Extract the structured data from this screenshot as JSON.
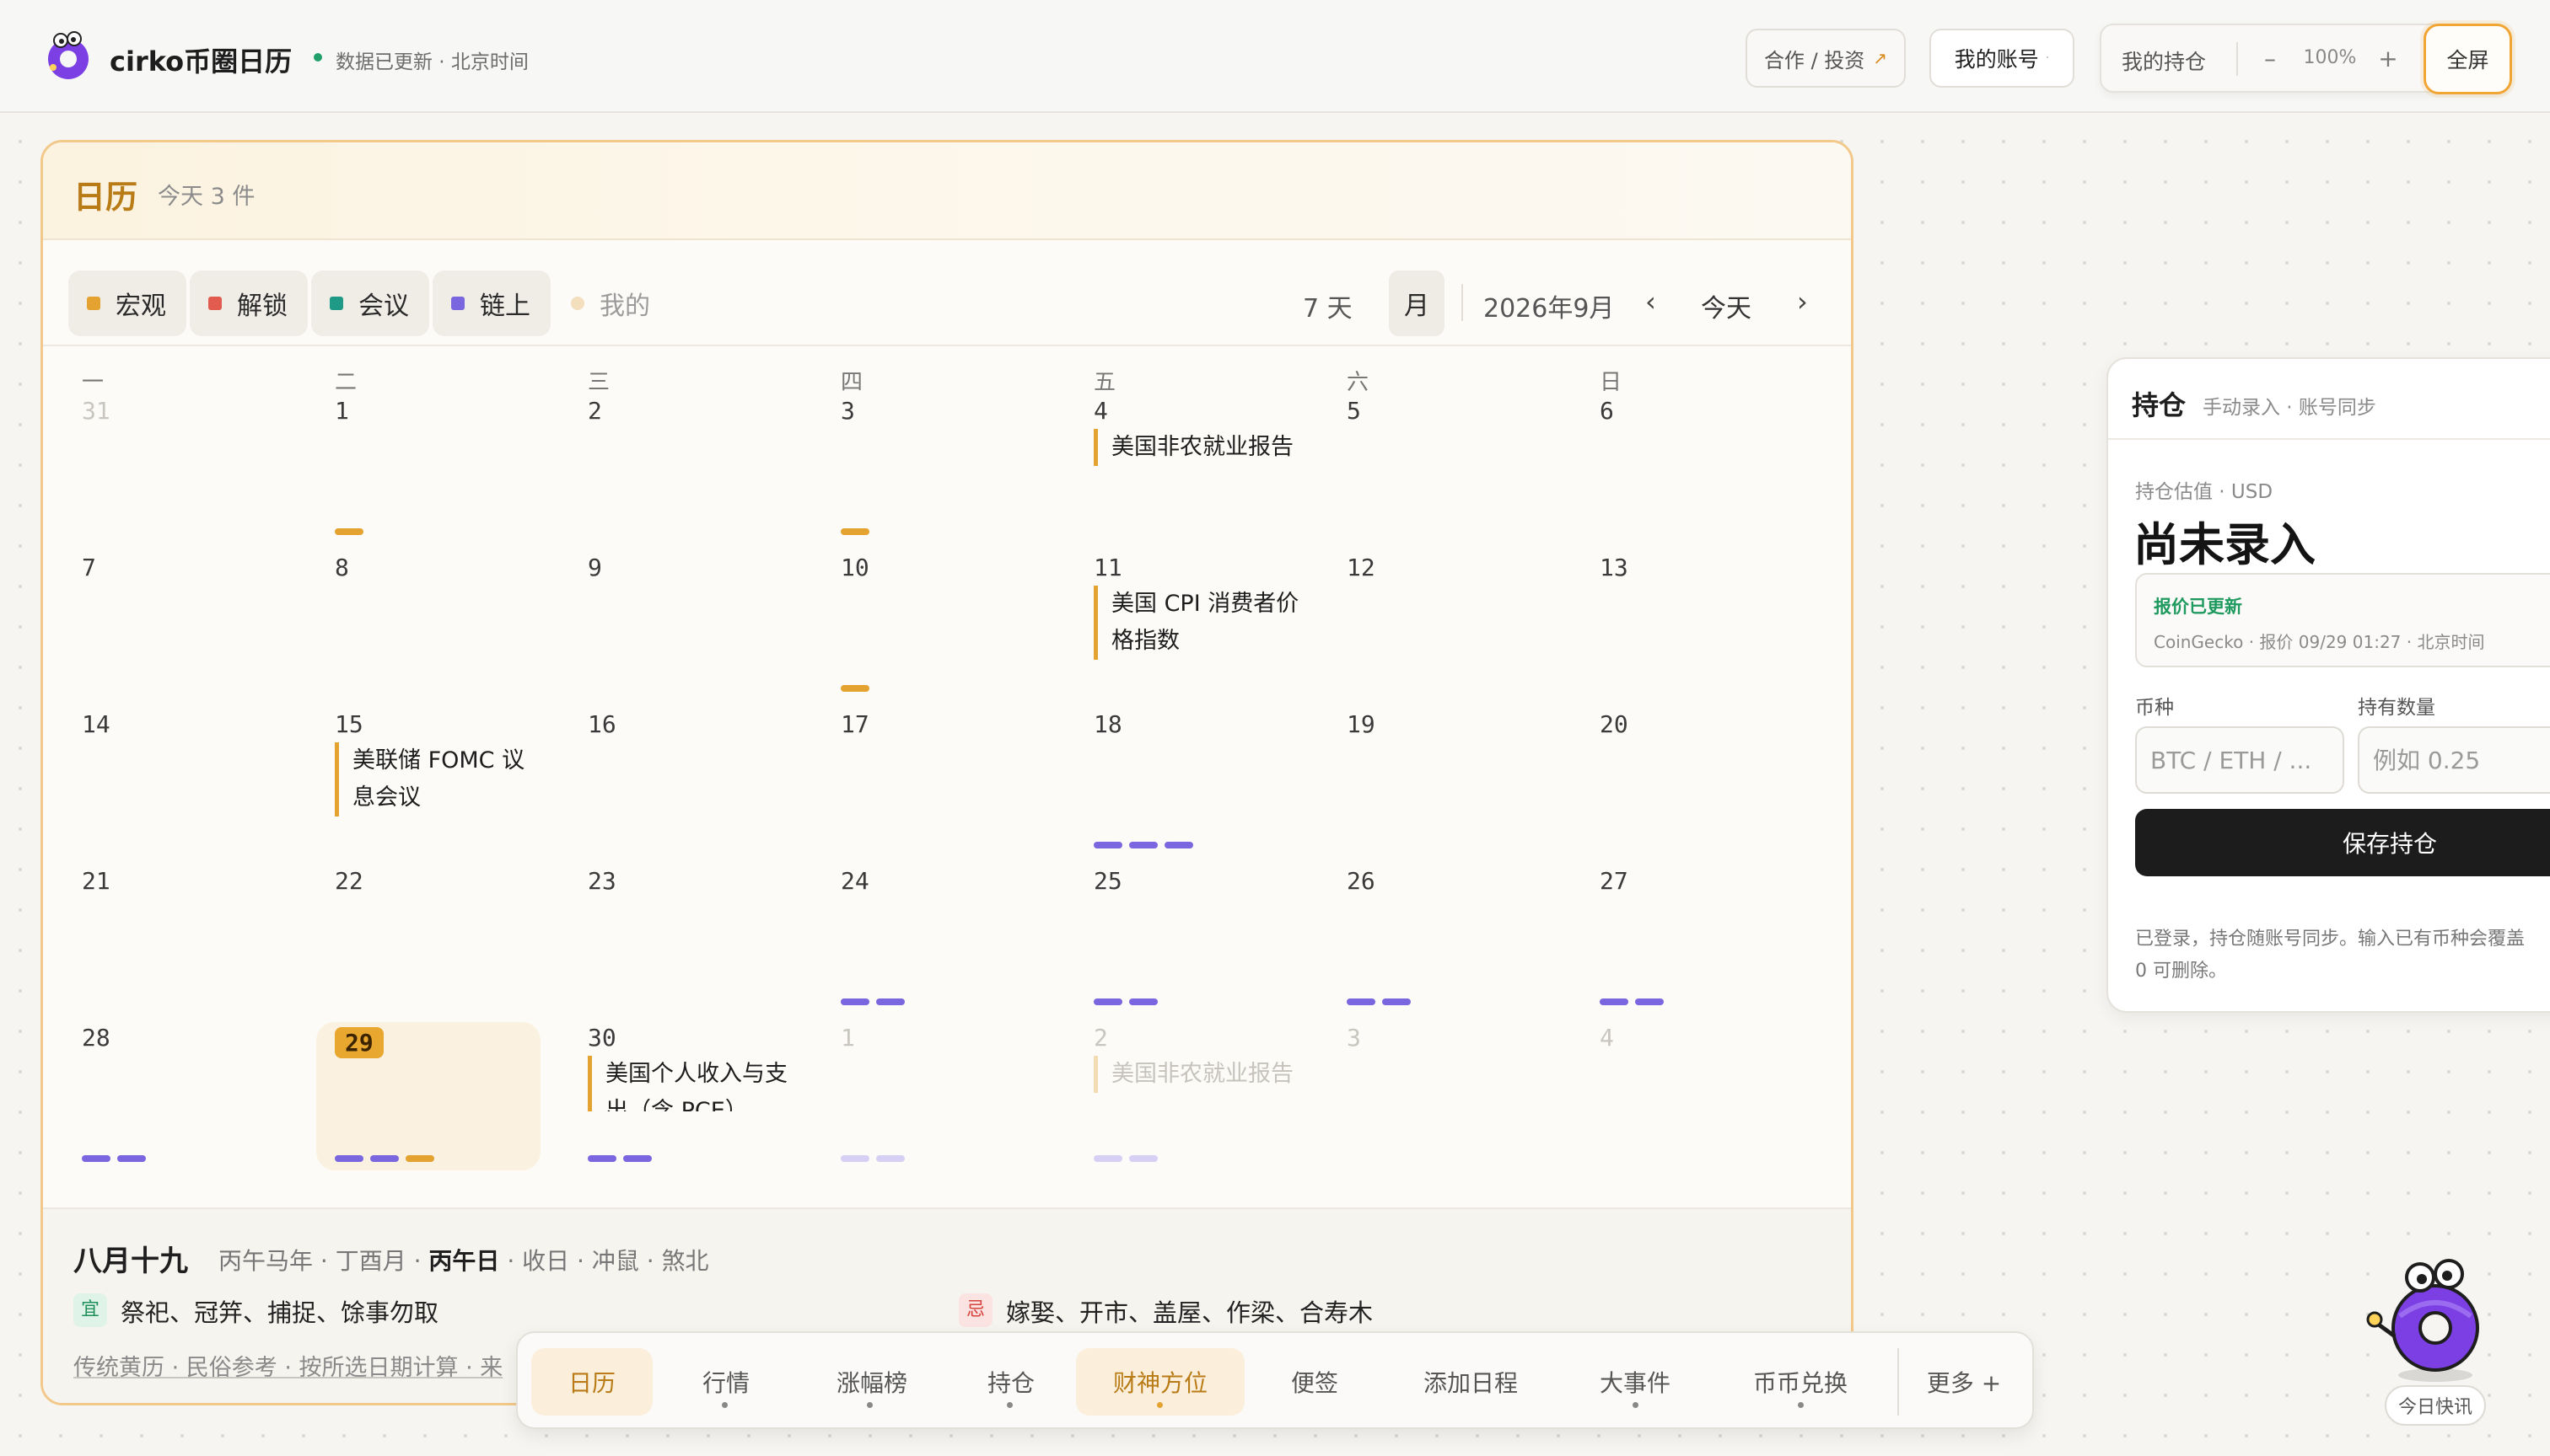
{
  "header": {
    "brand": "cirko币圈日历",
    "sync_status": "数据已更新 · 北京时间",
    "coop_label": "合作 / 投资",
    "coop_arrow": "↗",
    "account_label": "我的账号",
    "holdings_label": "我的持仓",
    "zoom_minus": "–",
    "zoom_value": "100%",
    "zoom_plus": "+",
    "fullscreen_label": "全屏"
  },
  "calendar": {
    "title": "日历",
    "today_count": "今天 3 件",
    "filters": [
      {
        "label": "宏观",
        "color": "#e4a231"
      },
      {
        "label": "解锁",
        "color": "#e15b4f"
      },
      {
        "label": "会议",
        "color": "#1f9a86"
      },
      {
        "label": "链上",
        "color": "#7a67e0"
      },
      {
        "label": "我的",
        "color": "#f3dfbe"
      }
    ],
    "view_week": "7 天",
    "view_month": "月",
    "month_label": "2026年9月",
    "nav_prev": "‹",
    "nav_today": "今天",
    "nav_next": "›",
    "weekdays": [
      "一",
      "二",
      "三",
      "四",
      "五",
      "六",
      "日"
    ],
    "weeks": [
      [
        {
          "day": "31",
          "faded": true
        },
        {
          "day": "1",
          "bars": [
            "o"
          ]
        },
        {
          "day": "2"
        },
        {
          "day": "3",
          "bars": [
            "o"
          ]
        },
        {
          "day": "4",
          "event": "美国非农就业报告"
        },
        {
          "day": "5"
        },
        {
          "day": "6"
        }
      ],
      [
        {
          "day": "7"
        },
        {
          "day": "8"
        },
        {
          "day": "9"
        },
        {
          "day": "10",
          "bars": [
            "o"
          ]
        },
        {
          "day": "11",
          "event": "美国 CPI 消费者价格指数"
        },
        {
          "day": "12"
        },
        {
          "day": "13"
        }
      ],
      [
        {
          "day": "14"
        },
        {
          "day": "15",
          "event": "美联储 FOMC 议息会议"
        },
        {
          "day": "16"
        },
        {
          "day": "17"
        },
        {
          "day": "18",
          "bars": [
            "p",
            "p",
            "p"
          ]
        },
        {
          "day": "19"
        },
        {
          "day": "20"
        }
      ],
      [
        {
          "day": "21"
        },
        {
          "day": "22"
        },
        {
          "day": "23"
        },
        {
          "day": "24",
          "bars": [
            "p",
            "p"
          ]
        },
        {
          "day": "25",
          "bars": [
            "p",
            "p"
          ]
        },
        {
          "day": "26",
          "bars": [
            "p",
            "p"
          ]
        },
        {
          "day": "27",
          "bars": [
            "p",
            "p"
          ]
        }
      ],
      [
        {
          "day": "28",
          "bars": [
            "p",
            "p"
          ]
        },
        {
          "day": "29",
          "today": true,
          "bars": [
            "p",
            "p",
            "o"
          ]
        },
        {
          "day": "30",
          "event": "美国个人收入与支出（含 PCE）",
          "bars": [
            "p",
            "p"
          ]
        },
        {
          "day": "1",
          "faded": true,
          "bars": [
            "pl",
            "pl"
          ]
        },
        {
          "day": "2",
          "faded": true,
          "event": "美国非农就业报告",
          "bars": [
            "pl",
            "pl"
          ]
        },
        {
          "day": "3",
          "faded": true
        },
        {
          "day": "4",
          "faded": true
        }
      ]
    ],
    "lunar": {
      "day": "八月十九",
      "info_pre": "丙午马年 · 丁酉月 · ",
      "info_bold": "丙午日",
      "info_post": " · 收日 · 冲鼠 · 煞北",
      "yi_tag": "宜",
      "yi_text": "祭祀、冠笄、捕捉、馀事勿取",
      "ji_tag": "忌",
      "ji_text": "嫁娶、开市、盖屋、作梁、合寿木",
      "note": "传统黄历 · 民俗参考 · 按所选日期计算 · 来"
    }
  },
  "holdings": {
    "title": "持仓",
    "subtitle": "手动录入 · 账号同步",
    "value_label": "持仓估值 · USD",
    "value": "尚未录入",
    "quote_status": "报价已更新",
    "quote_source": "CoinGecko · 报价 09/29 01:27 · 北京时间",
    "coin_label": "币种",
    "qty_label": "持有数量",
    "coin_placeholder": "BTC / ETH / ...",
    "qty_placeholder": "例如 0.25",
    "save_label": "保存持仓",
    "note_line1": "已登录，持仓随账号同步。输入已有币种会覆盖",
    "note_line2": "0 可删除。"
  },
  "dock": {
    "items": [
      "日历",
      "行情",
      "涨幅榜",
      "持仓",
      "财神方位",
      "便签",
      "添加日程",
      "大事件",
      "币币兑换"
    ],
    "more": "更多 +"
  },
  "mascot": {
    "label": "今日快讯"
  }
}
